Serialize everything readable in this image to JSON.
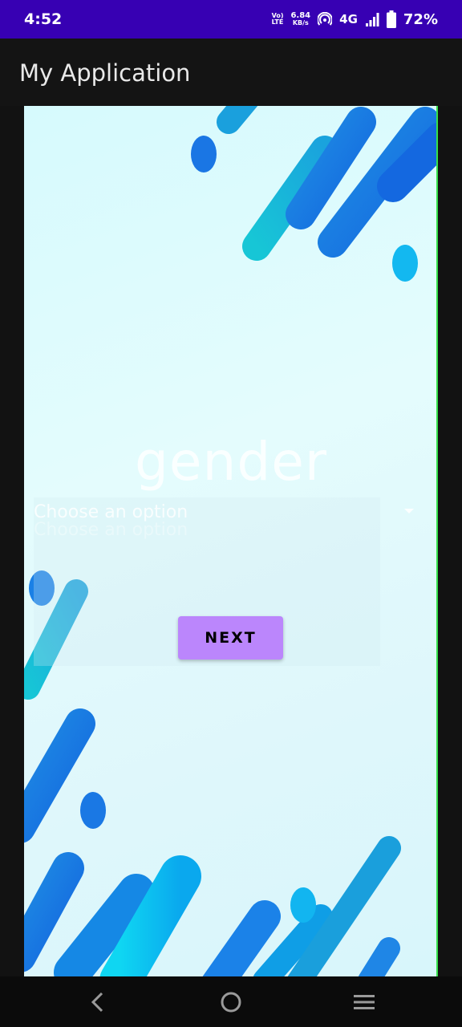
{
  "status_bar": {
    "time": "4:52",
    "volte_line1": "Vo)",
    "volte_line2": "LTE",
    "speed_value": "6.84",
    "speed_unit": "KB/s",
    "network": "4G",
    "battery": "72%"
  },
  "app_bar": {
    "title": "My Application"
  },
  "screen": {
    "heading": "gender",
    "spinner": {
      "selected": "Choose an option"
    },
    "next_button": "NEXT"
  },
  "colors": {
    "status_bar": "#3700b3",
    "app_bar": "#141414",
    "button": "#bb86fc",
    "accent_blue": "#1e7fe6",
    "accent_cyan": "#1ec8d8"
  },
  "icons": {
    "nav_back": "back-icon",
    "nav_home": "home-icon",
    "nav_recents": "menu-icon"
  }
}
